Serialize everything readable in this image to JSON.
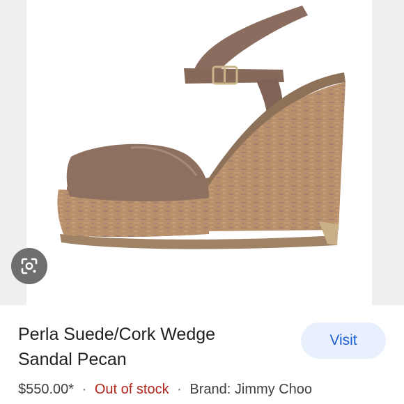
{
  "product": {
    "image_alt": "Perla Suede/Cork Wedge Sandal Pecan",
    "title_line1": "Perla Suede/Cork Wedge",
    "title_line2": "Sandal Pecan",
    "price": "$550.00*",
    "separator": "·",
    "stock_status": "Out of stock",
    "brand": "Brand: Jimmy Choo"
  },
  "actions": {
    "visit_label": "Visit",
    "lens_icon": "google-lens-icon"
  },
  "colors": {
    "visit_bg": "#e8f0fe",
    "visit_text": "#1a5fd6",
    "stock_text": "#b3261e",
    "suede": "#8b6e5e",
    "cork": "#b58b68"
  }
}
